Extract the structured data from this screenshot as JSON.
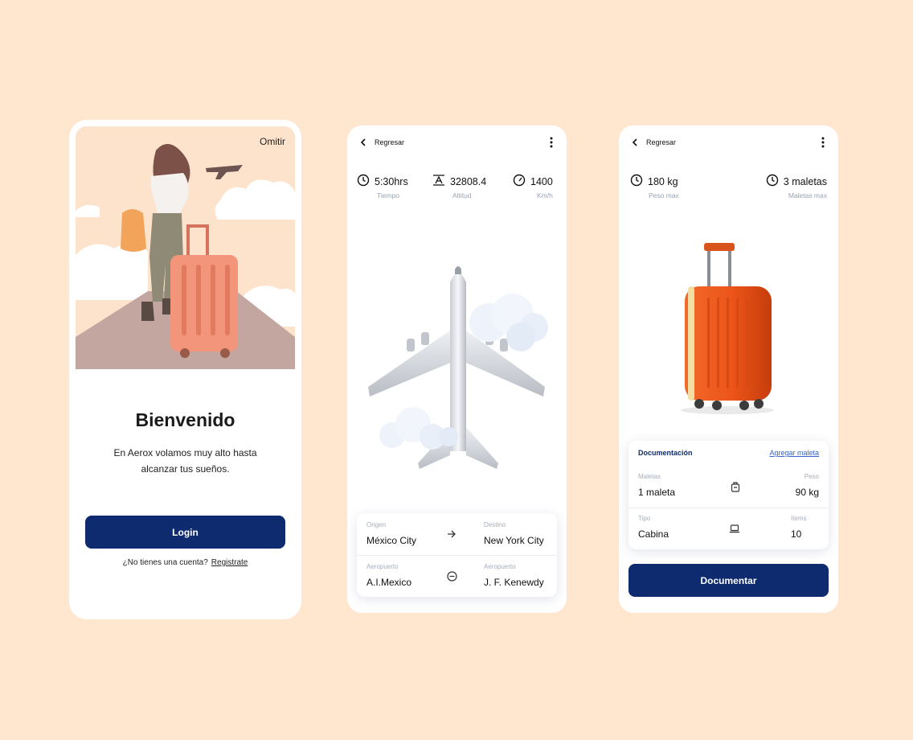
{
  "onboarding": {
    "skip_label": "Omitir",
    "title": "Bienvenido",
    "description": "En Aerox volamos muy alto hasta alcanzar tus sueños.",
    "login_label": "Login",
    "no_account_text": "¿No tienes una cuenta?",
    "register_label": "Registrate"
  },
  "flight": {
    "back_label": "Regresar",
    "stats": [
      {
        "icon": "clock-icon",
        "value": "5:30hrs",
        "label": "Tiempo"
      },
      {
        "icon": "altitude-icon",
        "value": "32808.4",
        "label": "Altitud"
      },
      {
        "icon": "speedometer-icon",
        "value": "1400",
        "label": "Km/h"
      }
    ],
    "origin_label": "Origen",
    "origin_value": "México City",
    "destination_label": "Destino",
    "destination_value": "New York City",
    "origin_airport_label": "Aeropuerto",
    "origin_airport_value": "A.I.Mexico",
    "dest_airport_label": "Aeropuerto",
    "dest_airport_value": "J. F. Kenewdy"
  },
  "baggage": {
    "back_label": "Regresar",
    "stats": [
      {
        "icon": "clock-icon",
        "value": "180 kg",
        "label": "Peso max"
      },
      {
        "icon": "clock-icon",
        "value": "3 maletas",
        "label": "Maletas max"
      }
    ],
    "card_title": "Documentación",
    "add_label": "Agregar maleta",
    "bags_label": "Maletas",
    "bags_value": "1 maleta",
    "weight_label": "Peso",
    "weight_value": "90 kg",
    "type_label": "Tipo",
    "type_value": "Cabina",
    "items_label": "Items",
    "items_value": "10",
    "submit_label": "Documentar"
  },
  "colors": {
    "background": "#ffe6cf",
    "primary": "#0d2b6e",
    "link": "#3a63c9",
    "suitcase": "#e8501e"
  }
}
